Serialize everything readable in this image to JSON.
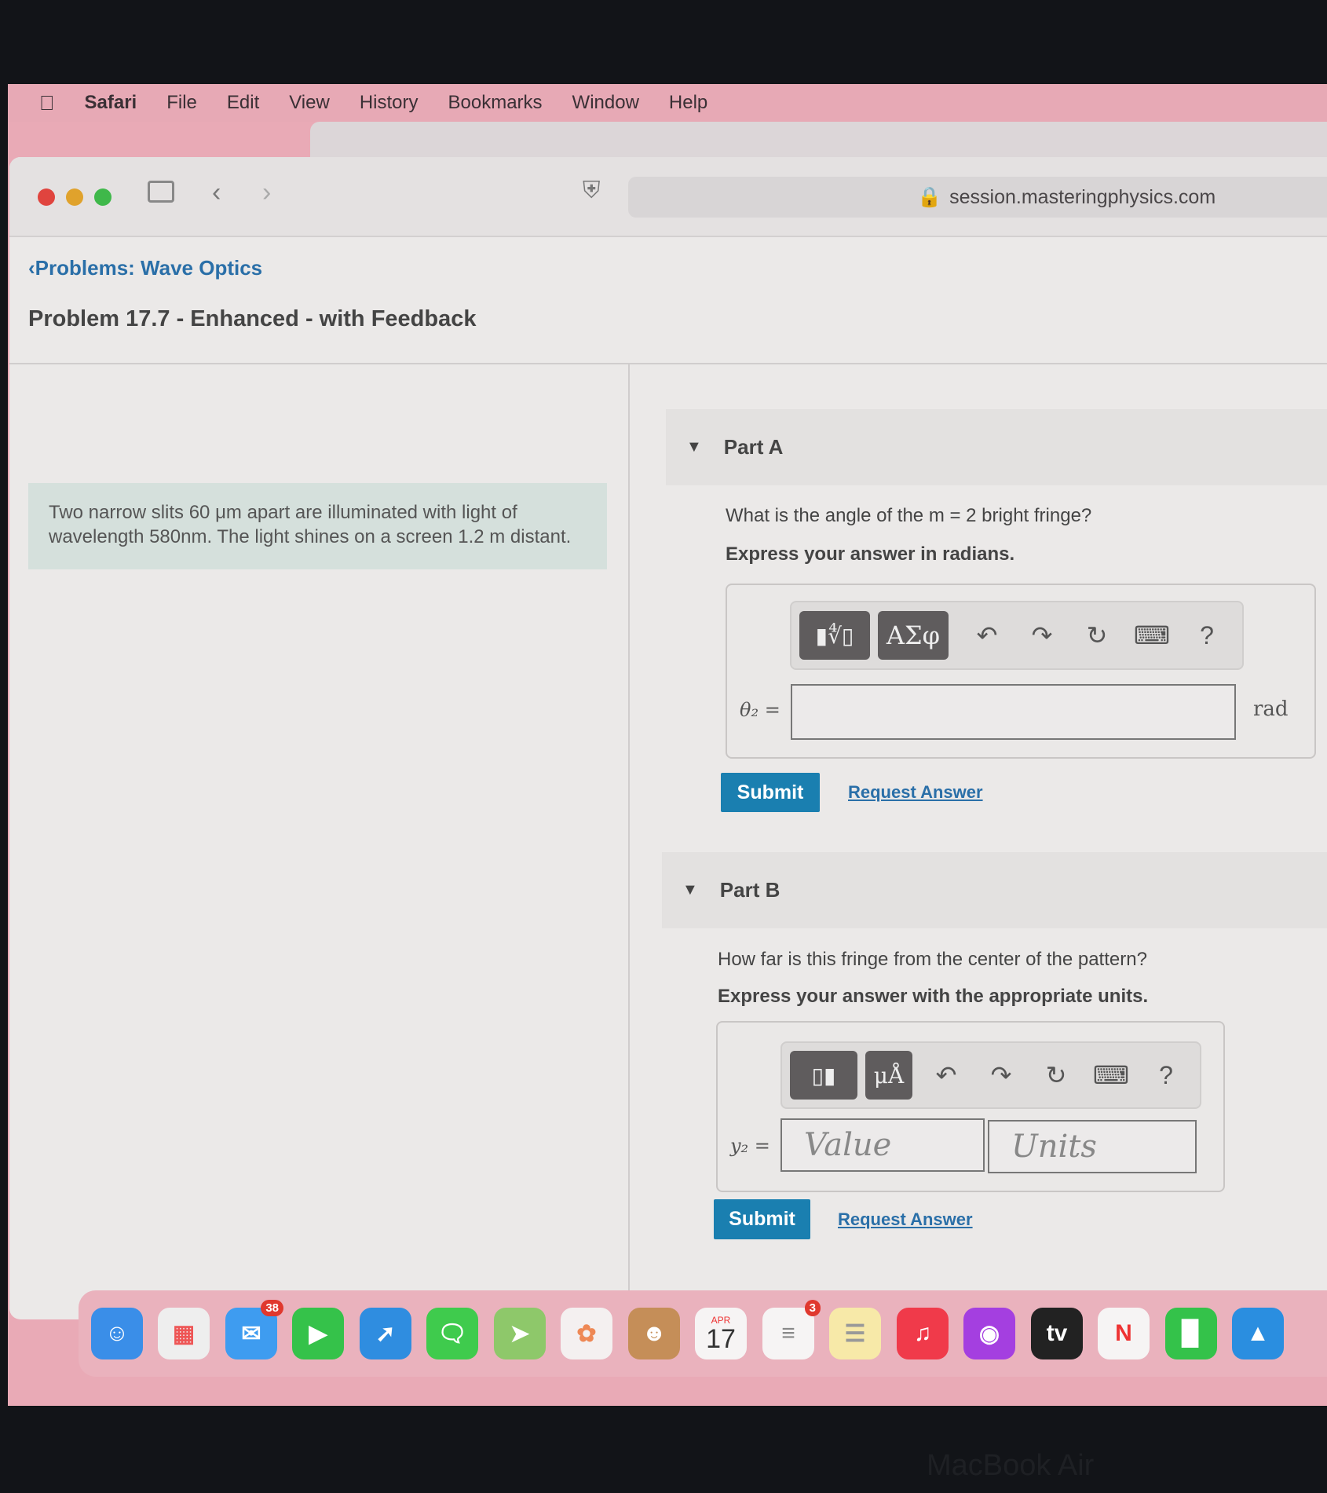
{
  "menubar": {
    "app": "Safari",
    "items": [
      "File",
      "Edit",
      "View",
      "History",
      "Bookmarks",
      "Window",
      "Help"
    ]
  },
  "browser": {
    "url": "session.masteringphysics.com"
  },
  "page": {
    "breadcrumb": "Problems: Wave Optics",
    "title": "Problem 17.7 - Enhanced - with Feedback",
    "intro": "Two narrow slits 60 μm apart are illuminated with light of wavelength 580nm. The light shines on a screen 1.2 m distant."
  },
  "partA": {
    "label": "Part A",
    "question": "What is the angle of the m = 2 bright fringe?",
    "instruction": "Express your answer in radians.",
    "templates_btn": "▮∜▯",
    "symbols_btn": "ΑΣφ",
    "help": "?",
    "var_label": "θ₂ =",
    "value": "",
    "unit": "rad",
    "submit": "Submit",
    "request": "Request Answer"
  },
  "partB": {
    "label": "Part B",
    "question": "How far is this fringe from the center of the pattern?",
    "instruction": "Express your answer with the appropriate units.",
    "templates_btn": "▯▮",
    "units_btn": "μÅ",
    "help": "?",
    "var_label": "y₂ =",
    "value_placeholder": "Value",
    "units_placeholder": "Units",
    "submit": "Submit",
    "request": "Request Answer"
  },
  "dock": {
    "mail_badge": "38",
    "calendar_month": "APR",
    "calendar_day": "17",
    "reminders_badge": "3",
    "tv": "tv"
  },
  "device": "MacBook Air"
}
